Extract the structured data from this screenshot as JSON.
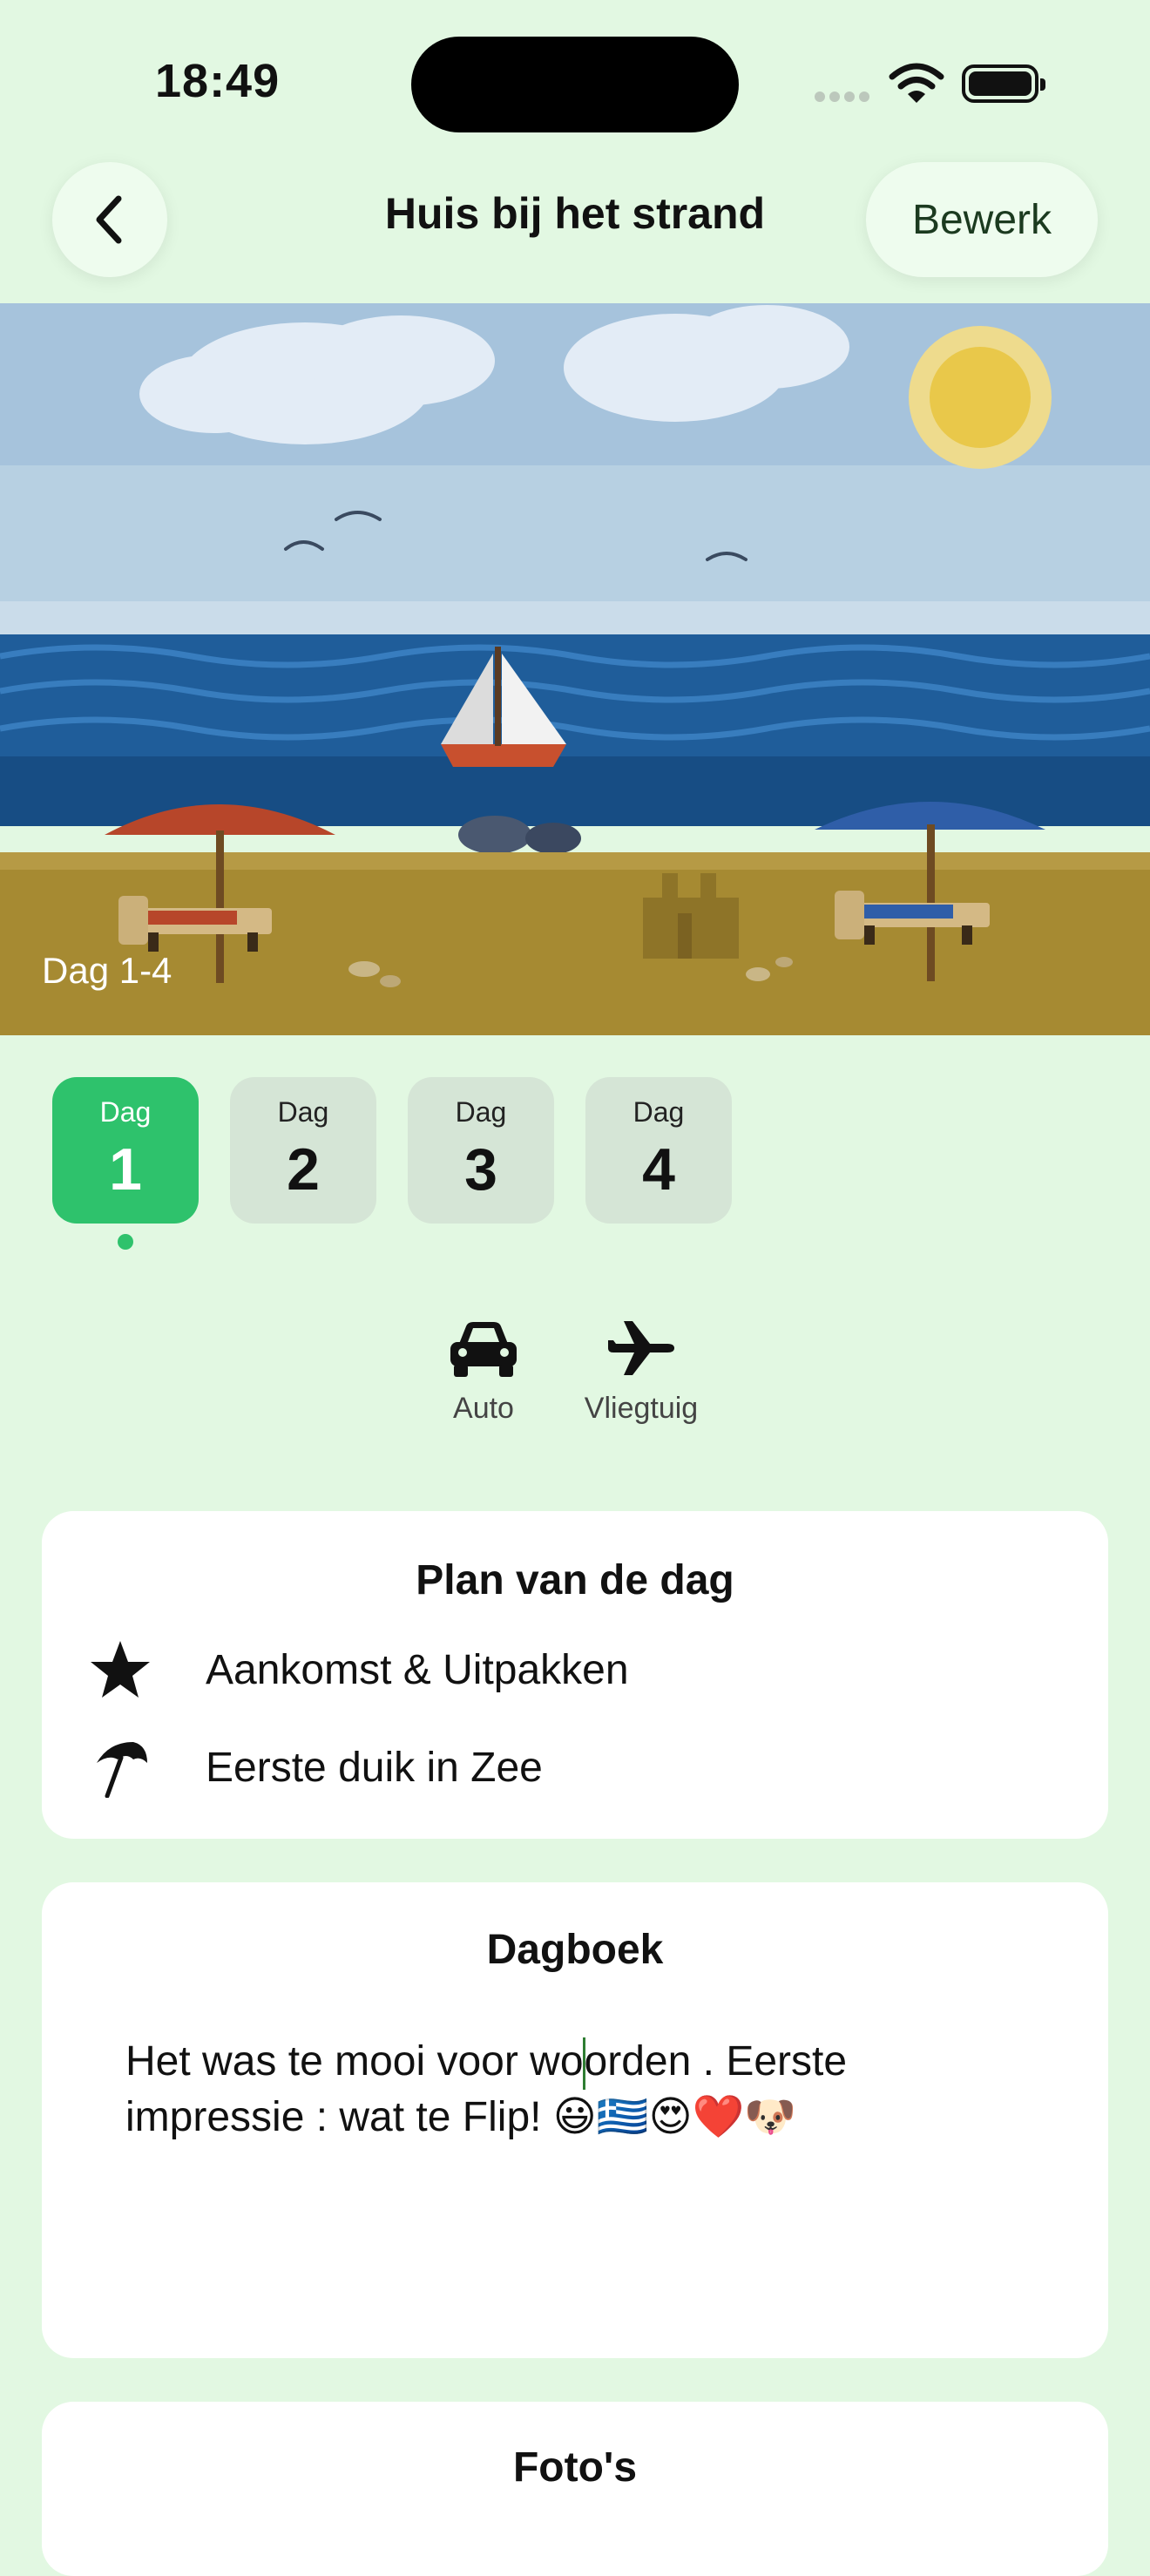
{
  "status_bar": {
    "time": "18:49"
  },
  "nav": {
    "title": "Huis bij het strand",
    "edit_label": "Bewerk"
  },
  "hero": {
    "label": "Dag 1-4"
  },
  "days": [
    {
      "label": "Dag",
      "number": "1",
      "active": true
    },
    {
      "label": "Dag",
      "number": "2",
      "active": false
    },
    {
      "label": "Dag",
      "number": "3",
      "active": false
    },
    {
      "label": "Dag",
      "number": "4",
      "active": false
    }
  ],
  "transport": [
    {
      "icon": "car-icon",
      "label": "Auto"
    },
    {
      "icon": "airplane-icon",
      "label": "Vliegtuig"
    }
  ],
  "plan": {
    "title": "Plan van de dag",
    "items": [
      {
        "icon": "star-icon",
        "label": "Aankomst & Uitpakken"
      },
      {
        "icon": "beach-umbrella-icon",
        "label": "Eerste duik in Zee"
      }
    ]
  },
  "diary": {
    "title": "Dagboek",
    "text_before_cursor": "Het was te mooi voor wo",
    "text_after_cursor": "orden . Eerste impressie : wat te Flip! 😃🇬🇷😍❤️🐶"
  },
  "photos": {
    "title": "Foto's"
  },
  "colors": {
    "accent": "#2ec26c",
    "background": "#e2f8e2",
    "chip_inactive": "#d5e5d6"
  }
}
